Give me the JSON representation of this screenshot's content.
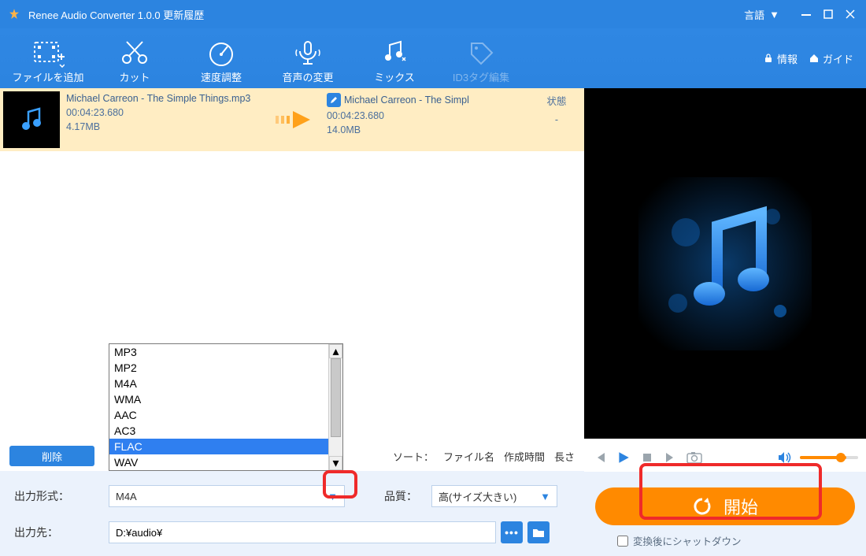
{
  "titlebar": {
    "app_title": "Renee Audio Converter 1.0.0 更新履歴",
    "language_label": "言語"
  },
  "toolbar": {
    "items": [
      {
        "label": "ファイルを追加"
      },
      {
        "label": "カット"
      },
      {
        "label": "速度調整"
      },
      {
        "label": "音声の変更"
      },
      {
        "label": "ミックス"
      },
      {
        "label": "ID3タグ編集"
      }
    ],
    "info_label": "情報",
    "guide_label": "ガイド"
  },
  "file_row": {
    "source": {
      "name": "Michael Carreon - The Simple Things.mp3",
      "duration": "00:04:23.680",
      "size": "4.17MB"
    },
    "target": {
      "name": "Michael Carreon - The Simpl",
      "duration": "00:04:23.680",
      "size": "14.0MB"
    },
    "status_header": "状態",
    "status_value": "-"
  },
  "list_footer": {
    "delete_label": "削除",
    "sort_label": "ソート：",
    "sort_options": [
      "ファイル名",
      "作成時間",
      "長さ"
    ]
  },
  "dropdown": {
    "items": [
      "MP3",
      "MP2",
      "M4A",
      "WMA",
      "AAC",
      "AC3",
      "FLAC",
      "WAV"
    ],
    "selected_index": 6
  },
  "bottom": {
    "format_label": "出力形式：",
    "format_value": "M4A",
    "quality_label": "品質：",
    "quality_value": "高(サイズ大きい)",
    "folder_label": "出力先：",
    "folder_value": "D:¥audio¥"
  },
  "right": {
    "start_label": "開始",
    "shutdown_label": "変換後にシャットダウン"
  }
}
